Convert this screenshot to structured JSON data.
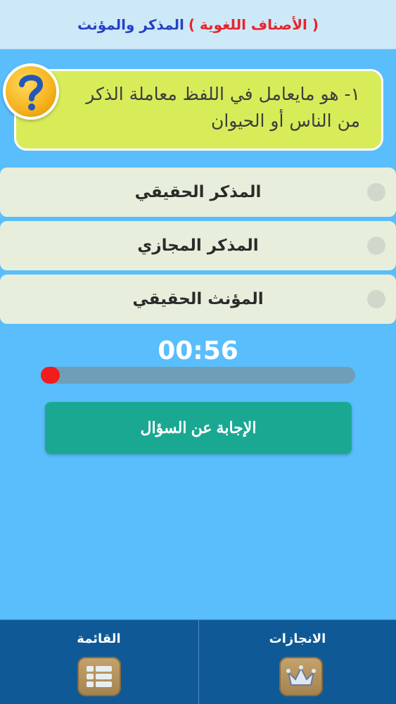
{
  "header": {
    "category": "( الأصناف اللغوية )",
    "subtitle": "المذكر والمؤنث"
  },
  "question": {
    "text": "١- هو مايعامل في اللفظ معاملة الذكر من الناس أو الحيوان",
    "icon": "question-mark-icon"
  },
  "options": [
    {
      "label": "المذكر الحقيقي",
      "selected": false
    },
    {
      "label": "المذكر المجازي",
      "selected": false
    },
    {
      "label": "المؤنث الحقيقي",
      "selected": false
    }
  ],
  "timer": {
    "display": "00:56",
    "progress_fraction": 0.06
  },
  "answer_button": {
    "label": "الإجابة عن السؤال"
  },
  "bottom_nav": {
    "menu": {
      "label": "القائمة",
      "icon": "menu-list-icon"
    },
    "achievements": {
      "label": "الانجازات",
      "icon": "crown-icon"
    }
  },
  "colors": {
    "background": "#59befb",
    "question_card": "#d8ec59",
    "answer_button": "#1aa893",
    "progress_fill": "#f21c1c",
    "bottom_bar": "#0f5a96"
  }
}
